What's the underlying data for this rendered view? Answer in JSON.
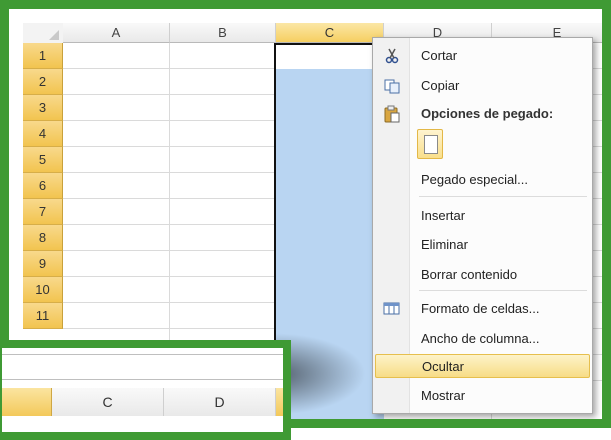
{
  "spreadsheet": {
    "corner_label": "",
    "columns": [
      "A",
      "B",
      "C",
      "D",
      "E"
    ],
    "selected_column": "C",
    "rows": [
      "1",
      "2",
      "3",
      "4",
      "5",
      "6",
      "7",
      "8",
      "9",
      "10",
      "11"
    ]
  },
  "context_menu": {
    "items": [
      {
        "label": "Cortar",
        "icon": "scissors-icon"
      },
      {
        "label": "Copiar",
        "icon": "copy-icon"
      },
      {
        "label": "Opciones de pegado:",
        "icon": "clipboard-icon",
        "bold": true
      },
      {
        "label": "Pegado especial...",
        "icon": ""
      },
      {
        "label": "Insertar",
        "icon": ""
      },
      {
        "label": "Eliminar",
        "icon": ""
      },
      {
        "label": "Borrar contenido",
        "icon": ""
      },
      {
        "label": "Formato de celdas...",
        "icon": "format-cells-icon"
      },
      {
        "label": "Ancho de columna...",
        "icon": ""
      },
      {
        "label": "Ocultar",
        "icon": "",
        "highlighted": true
      },
      {
        "label": "Mostrar",
        "icon": ""
      }
    ]
  },
  "inset": {
    "columns": [
      "",
      "C",
      "D"
    ]
  },
  "colors": {
    "frame_green": "#3f9a34",
    "selection_blue": "#b9d5f2",
    "header_gold": "#f2c44f"
  }
}
